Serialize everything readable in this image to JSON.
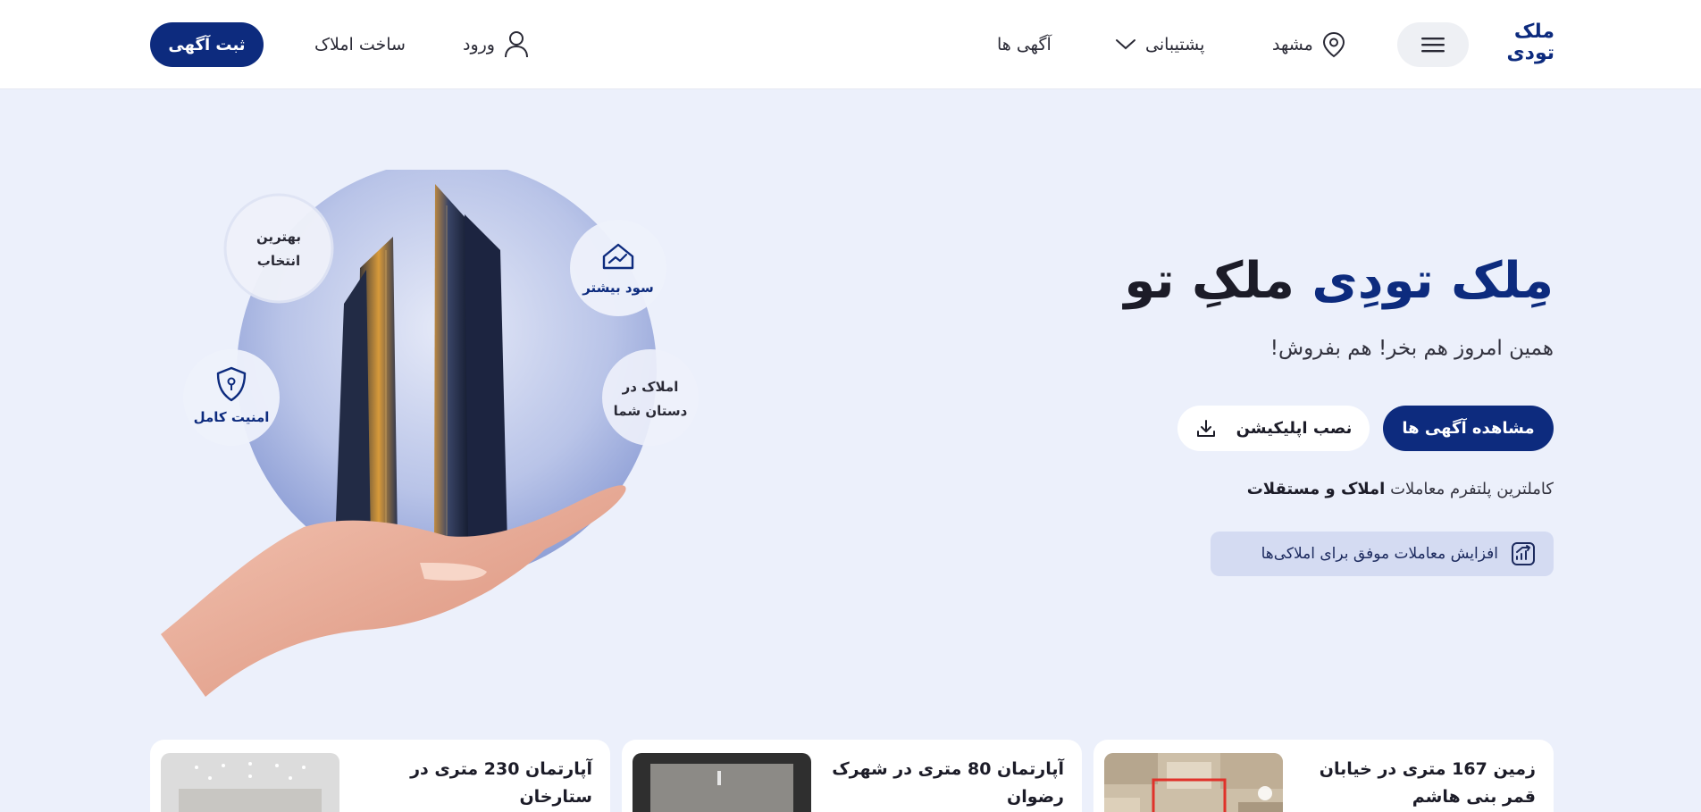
{
  "header": {
    "logo_line1": "ملک",
    "logo_line2": "تودی",
    "menu_icon": "hamburger-menu-icon",
    "city": "مشهد",
    "support": "پشتیبانی",
    "ads": "آگهی ها",
    "login": "ورود",
    "build": "ساخت املاک",
    "post_ad": "ثبت آگهی"
  },
  "hero": {
    "title_part1": "مِلک تودِی",
    "title_part2": " ملکِ تو",
    "subtitle": "همین امروز هم بخر! هم بفروش!",
    "view_ads_button": "مشاهده آگهی ها",
    "install_app_button": "نصب اپلیکیشن",
    "desc_prefix": "کاملترین پلتفرم معاملات",
    "desc_bold": "املاک و مستقلات",
    "badge_text": "افزایش معاملات موفق برای املاکی‌ها"
  },
  "illustration": {
    "feature1": "سود بیشتر",
    "feature2_line1": "بهترین",
    "feature2_line2": "انتخاب",
    "feature3_line1": "املاک در",
    "feature3_line2": "دستان شما",
    "feature4": "امنیت کامل"
  },
  "listings": [
    {
      "title": "زمین 167 متری در خیابان قمر بنی هاشم"
    },
    {
      "title": "آپارتمان 80 متری در شهرک رضوان"
    },
    {
      "title": "آپارتمان 230 متری در ستارخان"
    }
  ],
  "colors": {
    "brand": "#0d2b7e",
    "background": "#ecf0fb",
    "badge_bg": "#d4dbf2"
  }
}
